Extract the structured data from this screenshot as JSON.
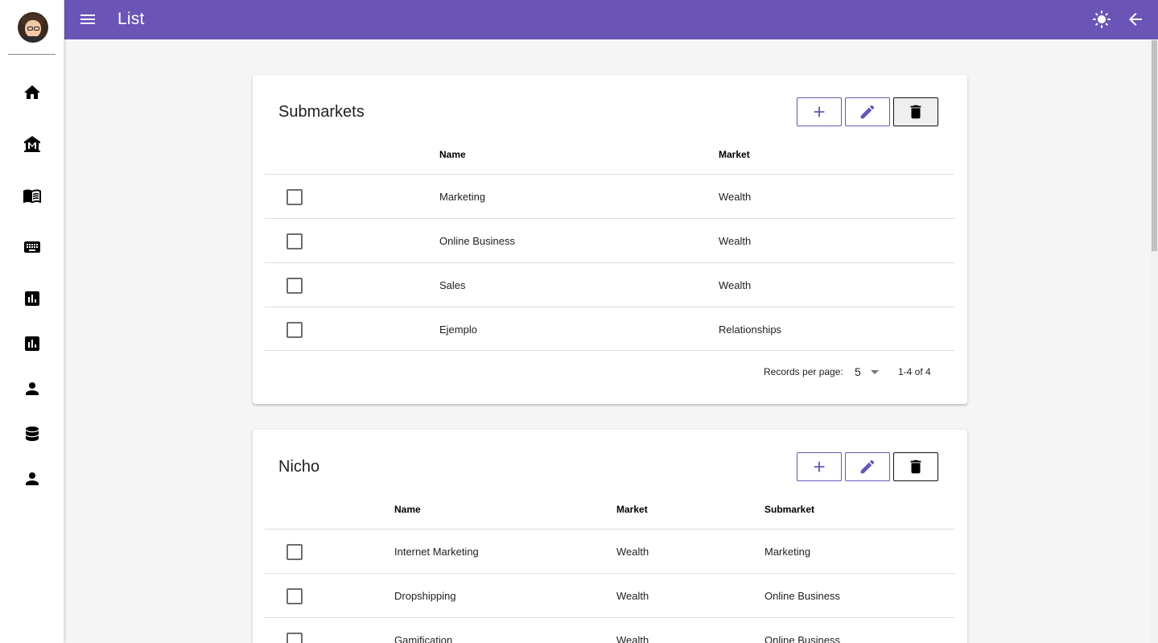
{
  "app": {
    "title": "List"
  },
  "sidebar": {
    "avatar_alt": "",
    "items": [
      {
        "icon": "home-icon"
      },
      {
        "icon": "museum-icon"
      },
      {
        "icon": "menu-book-icon"
      },
      {
        "icon": "keyboard-icon"
      },
      {
        "icon": "bar-chart-icon"
      },
      {
        "icon": "bar-chart-icon"
      },
      {
        "icon": "person-icon"
      },
      {
        "icon": "database-icon"
      },
      {
        "icon": "person-icon"
      }
    ]
  },
  "topbar": {
    "left_icon": "menu-icon",
    "right_icons": [
      "brightness-icon",
      "arrow-back-icon"
    ]
  },
  "submarkets": {
    "title": "Submarkets",
    "columns": [
      "Name",
      "Market"
    ],
    "rows": [
      {
        "name": "Marketing",
        "market": "Wealth"
      },
      {
        "name": "Online Business",
        "market": "Wealth"
      },
      {
        "name": "Sales",
        "market": "Wealth"
      },
      {
        "name": "Ejemplo",
        "market": "Relationships"
      }
    ],
    "footer": {
      "records_label": "Records per page:",
      "per_page": "5",
      "range": "1-4 of 4"
    }
  },
  "nicho": {
    "title": "Nicho",
    "columns": [
      "Name",
      "Market",
      "Submarket"
    ],
    "rows": [
      {
        "name": "Internet Marketing",
        "market": "Wealth",
        "submarket": "Marketing"
      },
      {
        "name": "Dropshipping",
        "market": "Wealth",
        "submarket": "Online Business"
      },
      {
        "name": "Gamification",
        "market": "Wealth",
        "submarket": "Online Business"
      }
    ]
  },
  "colors": {
    "primary": "#6a55b6",
    "background": "#f5f5f5"
  }
}
